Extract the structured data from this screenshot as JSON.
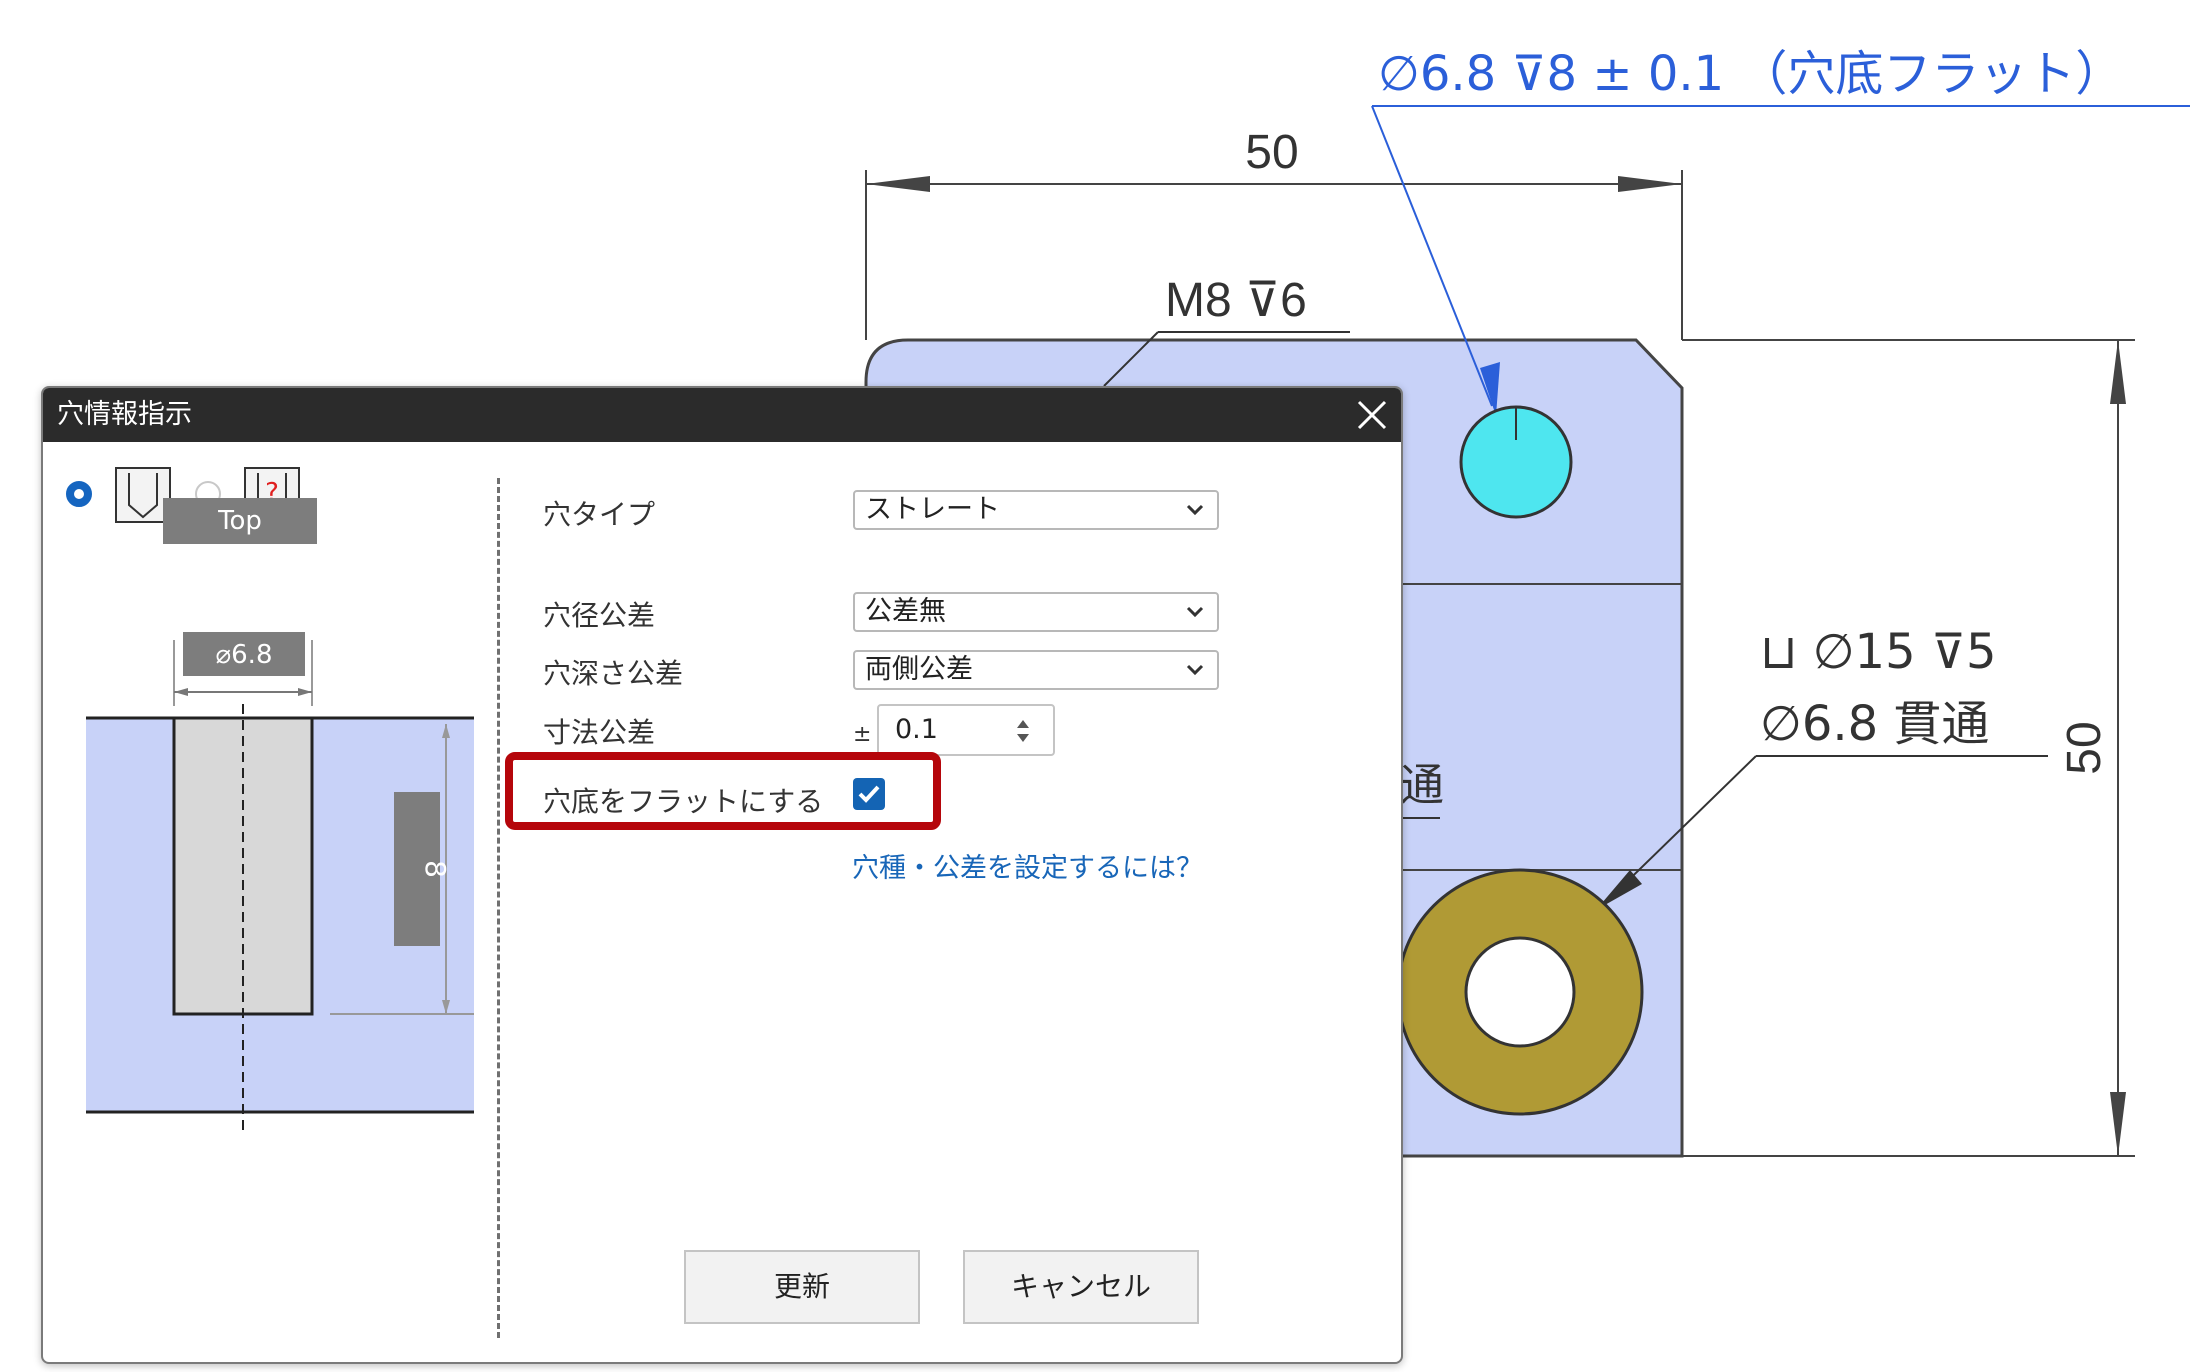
{
  "drawing": {
    "callout_top": "∅6.8 ⊽8 ± 0.1 （穴底フラット）",
    "dim_top": "50",
    "callout_m8": "M8 ⊽6",
    "callout_cbore_line1": "⊔ ∅15 ⊽5",
    "callout_cbore_line2": "∅6.8 貫通",
    "dim_right": "50",
    "partial_text": "通"
  },
  "dialog": {
    "title": "穴情報指示",
    "preview": {
      "top_label": "Top",
      "diameter_label": "⌀6.8",
      "depth_label": "8"
    },
    "fields": {
      "hole_type_label": "穴タイプ",
      "hole_type_value": "ストレート",
      "diameter_tol_label": "穴径公差",
      "diameter_tol_value": "公差無",
      "depth_tol_label": "穴深さ公差",
      "depth_tol_value": "両側公差",
      "dim_tol_label": "寸法公差",
      "dim_tol_prefix": "±",
      "dim_tol_value": "0.1",
      "flat_bottom_label": "穴底をフラットにする",
      "flat_bottom_checked": true
    },
    "help_link": "穴種・公差を設定するには？",
    "buttons": {
      "update": "更新",
      "cancel": "キャンセル"
    }
  },
  "colors": {
    "part_fill": "#c8d2f8",
    "callout_blue": "#2b5fd9",
    "highlight_red": "#b5060b",
    "hole_cyan": "#4ee6ef",
    "counterbore_gold": "#b09a35"
  }
}
